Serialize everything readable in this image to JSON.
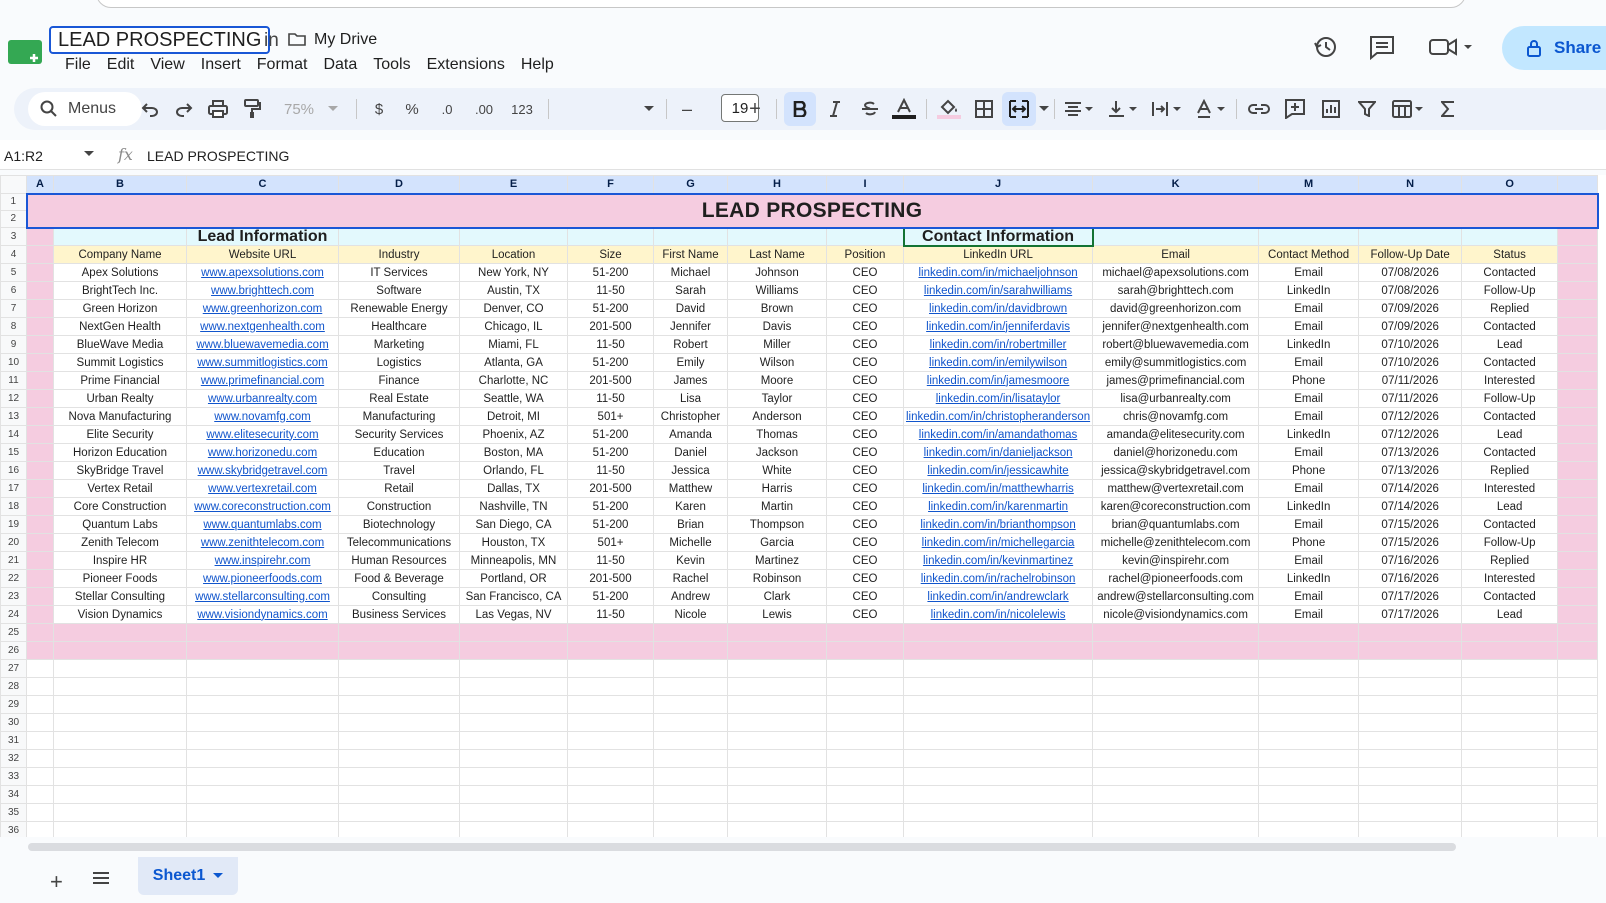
{
  "doc": {
    "title": "LEAD PROSPECTING",
    "in_label": "in",
    "location": "My Drive"
  },
  "menu": [
    "File",
    "Edit",
    "View",
    "Insert",
    "Format",
    "Data",
    "Tools",
    "Extensions",
    "Help"
  ],
  "header_actions": {
    "share_label": "Share",
    "icons": [
      "history-icon",
      "comment-icon",
      "meet-video-icon",
      "lock-icon"
    ]
  },
  "toolbar": {
    "search_label": "Menus",
    "zoom": "75%",
    "currency": "$",
    "percent": "%",
    "decimal_decrease": ".0",
    "decimal_increase": ".00",
    "number_format": "123",
    "font_size": "19",
    "minus": "–",
    "plus": "+"
  },
  "formula_bar": {
    "name_box": "A1:R2",
    "fx": "fx",
    "content": "LEAD PROSPECTING"
  },
  "columns": [
    "A",
    "B",
    "C",
    "D",
    "E",
    "F",
    "G",
    "H",
    "I",
    "J",
    "K",
    "M",
    "N",
    "O"
  ],
  "sheet": {
    "title": "LEAD PROSPECTING",
    "lead_section": "Lead Information",
    "contact_section": "Contact Information",
    "headers": [
      "Company Name",
      "Website URL",
      "Industry",
      "Location",
      "Size",
      "First Name",
      "Last Name",
      "Position",
      "LinkedIn URL",
      "Email",
      "Contact Method",
      "Follow-Up Date",
      "Status"
    ],
    "rows": [
      [
        "Apex Solutions",
        "www.apexsolutions.com",
        "IT Services",
        "New York, NY",
        "51-200",
        "Michael",
        "Johnson",
        "CEO",
        "linkedin.com/in/michaeljohnson",
        "michael@apexsolutions.com",
        "Email",
        "07/08/2026",
        "Contacted"
      ],
      [
        "BrightTech Inc.",
        "www.brighttech.com",
        "Software",
        "Austin, TX",
        "11-50",
        "Sarah",
        "Williams",
        "CEO",
        "linkedin.com/in/sarahwilliams",
        "sarah@brighttech.com",
        "LinkedIn",
        "07/08/2026",
        "Follow-Up"
      ],
      [
        "Green Horizon",
        "www.greenhorizon.com",
        "Renewable Energy",
        "Denver, CO",
        "51-200",
        "David",
        "Brown",
        "CEO",
        "linkedin.com/in/davidbrown",
        "david@greenhorizon.com",
        "Email",
        "07/09/2026",
        "Replied"
      ],
      [
        "NextGen Health",
        "www.nextgenhealth.com",
        "Healthcare",
        "Chicago, IL",
        "201-500",
        "Jennifer",
        "Davis",
        "CEO",
        "linkedin.com/in/jenniferdavis",
        "jennifer@nextgenhealth.com",
        "Email",
        "07/09/2026",
        "Contacted"
      ],
      [
        "BlueWave Media",
        "www.bluewavemedia.com",
        "Marketing",
        "Miami, FL",
        "11-50",
        "Robert",
        "Miller",
        "CEO",
        "linkedin.com/in/robertmiller",
        "robert@bluewavemedia.com",
        "LinkedIn",
        "07/10/2026",
        "Lead"
      ],
      [
        "Summit Logistics",
        "www.summitlogistics.com",
        "Logistics",
        "Atlanta, GA",
        "51-200",
        "Emily",
        "Wilson",
        "CEO",
        "linkedin.com/in/emilywilson",
        "emily@summitlogistics.com",
        "Email",
        "07/10/2026",
        "Contacted"
      ],
      [
        "Prime Financial",
        "www.primefinancial.com",
        "Finance",
        "Charlotte, NC",
        "201-500",
        "James",
        "Moore",
        "CEO",
        "linkedin.com/in/jamesmoore",
        "james@primefinancial.com",
        "Phone",
        "07/11/2026",
        "Interested"
      ],
      [
        "Urban Realty",
        "www.urbanrealty.com",
        "Real Estate",
        "Seattle, WA",
        "11-50",
        "Lisa",
        "Taylor",
        "CEO",
        "linkedin.com/in/lisataylor",
        "lisa@urbanrealty.com",
        "Email",
        "07/11/2026",
        "Follow-Up"
      ],
      [
        "Nova Manufacturing",
        "www.novamfg.com",
        "Manufacturing",
        "Detroit, MI",
        "501+",
        "Christopher",
        "Anderson",
        "CEO",
        "linkedin.com/in/christopheranderson",
        "chris@novamfg.com",
        "Email",
        "07/12/2026",
        "Contacted"
      ],
      [
        "Elite Security",
        "www.elitesecurity.com",
        "Security Services",
        "Phoenix, AZ",
        "51-200",
        "Amanda",
        "Thomas",
        "CEO",
        "linkedin.com/in/amandathomas",
        "amanda@elitesecurity.com",
        "LinkedIn",
        "07/12/2026",
        "Lead"
      ],
      [
        "Horizon Education",
        "www.horizonedu.com",
        "Education",
        "Boston, MA",
        "51-200",
        "Daniel",
        "Jackson",
        "CEO",
        "linkedin.com/in/danieljackson",
        "daniel@horizonedu.com",
        "Email",
        "07/13/2026",
        "Contacted"
      ],
      [
        "SkyBridge Travel",
        "www.skybridgetravel.com",
        "Travel",
        "Orlando, FL",
        "11-50",
        "Jessica",
        "White",
        "CEO",
        "linkedin.com/in/jessicawhite",
        "jessica@skybridgetravel.com",
        "Phone",
        "07/13/2026",
        "Replied"
      ],
      [
        "Vertex Retail",
        "www.vertexretail.com",
        "Retail",
        "Dallas, TX",
        "201-500",
        "Matthew",
        "Harris",
        "CEO",
        "linkedin.com/in/matthewharris",
        "matthew@vertexretail.com",
        "Email",
        "07/14/2026",
        "Interested"
      ],
      [
        "Core Construction",
        "www.coreconstruction.com",
        "Construction",
        "Nashville, TN",
        "51-200",
        "Karen",
        "Martin",
        "CEO",
        "linkedin.com/in/karenmartin",
        "karen@coreconstruction.com",
        "LinkedIn",
        "07/14/2026",
        "Lead"
      ],
      [
        "Quantum Labs",
        "www.quantumlabs.com",
        "Biotechnology",
        "San Diego, CA",
        "51-200",
        "Brian",
        "Thompson",
        "CEO",
        "linkedin.com/in/brianthompson",
        "brian@quantumlabs.com",
        "Email",
        "07/15/2026",
        "Contacted"
      ],
      [
        "Zenith Telecom",
        "www.zenithtelecom.com",
        "Telecommunications",
        "Houston, TX",
        "501+",
        "Michelle",
        "Garcia",
        "CEO",
        "linkedin.com/in/michellegarcia",
        "michelle@zenithtelecom.com",
        "Phone",
        "07/15/2026",
        "Follow-Up"
      ],
      [
        "Inspire HR",
        "www.inspirehr.com",
        "Human Resources",
        "Minneapolis, MN",
        "11-50",
        "Kevin",
        "Martinez",
        "CEO",
        "linkedin.com/in/kevinmartinez",
        "kevin@inspirehr.com",
        "Email",
        "07/16/2026",
        "Replied"
      ],
      [
        "Pioneer Foods",
        "www.pioneerfoods.com",
        "Food & Beverage",
        "Portland, OR",
        "201-500",
        "Rachel",
        "Robinson",
        "CEO",
        "linkedin.com/in/rachelrobinson",
        "rachel@pioneerfoods.com",
        "LinkedIn",
        "07/16/2026",
        "Interested"
      ],
      [
        "Stellar Consulting",
        "www.stellarconsulting.com",
        "Consulting",
        "San Francisco, CA",
        "51-200",
        "Andrew",
        "Clark",
        "CEO",
        "linkedin.com/in/andrewclark",
        "andrew@stellarconsulting.com",
        "Email",
        "07/17/2026",
        "Contacted"
      ],
      [
        "Vision Dynamics",
        "www.visiondynamics.com",
        "Business Services",
        "Las Vegas, NV",
        "11-50",
        "Nicole",
        "Lewis",
        "CEO",
        "linkedin.com/in/nicolelewis",
        "nicole@visiondynamics.com",
        "Email",
        "07/17/2026",
        "Lead"
      ]
    ],
    "row_numbers": [
      "1",
      "2",
      "3",
      "4",
      "5",
      "6",
      "7",
      "8",
      "9",
      "10",
      "11",
      "12",
      "13",
      "14",
      "15",
      "16",
      "17",
      "18",
      "19",
      "20",
      "21",
      "22",
      "23",
      "24",
      "25",
      "26",
      "27",
      "28",
      "29",
      "30",
      "31",
      "32",
      "33",
      "34",
      "35",
      "36"
    ]
  },
  "sheet_tabs": {
    "add": "+",
    "active": "Sheet1"
  },
  "colors": {
    "pink": "#f5cce0",
    "cyan": "#e3f9fd",
    "yellow": "#fff5cc",
    "accent": "#0b57d0",
    "link": "#1155cc"
  }
}
